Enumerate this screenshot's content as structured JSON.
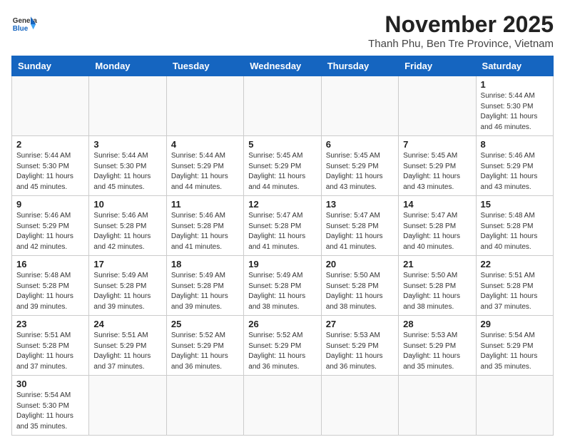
{
  "header": {
    "logo_general": "General",
    "logo_blue": "Blue",
    "month_title": "November 2025",
    "location": "Thanh Phu, Ben Tre Province, Vietnam"
  },
  "days_of_week": [
    "Sunday",
    "Monday",
    "Tuesday",
    "Wednesday",
    "Thursday",
    "Friday",
    "Saturday"
  ],
  "weeks": [
    [
      {
        "day": "",
        "info": ""
      },
      {
        "day": "",
        "info": ""
      },
      {
        "day": "",
        "info": ""
      },
      {
        "day": "",
        "info": ""
      },
      {
        "day": "",
        "info": ""
      },
      {
        "day": "",
        "info": ""
      },
      {
        "day": "1",
        "info": "Sunrise: 5:44 AM\nSunset: 5:30 PM\nDaylight: 11 hours\nand 46 minutes."
      }
    ],
    [
      {
        "day": "2",
        "info": "Sunrise: 5:44 AM\nSunset: 5:30 PM\nDaylight: 11 hours\nand 45 minutes."
      },
      {
        "day": "3",
        "info": "Sunrise: 5:44 AM\nSunset: 5:30 PM\nDaylight: 11 hours\nand 45 minutes."
      },
      {
        "day": "4",
        "info": "Sunrise: 5:44 AM\nSunset: 5:29 PM\nDaylight: 11 hours\nand 44 minutes."
      },
      {
        "day": "5",
        "info": "Sunrise: 5:45 AM\nSunset: 5:29 PM\nDaylight: 11 hours\nand 44 minutes."
      },
      {
        "day": "6",
        "info": "Sunrise: 5:45 AM\nSunset: 5:29 PM\nDaylight: 11 hours\nand 43 minutes."
      },
      {
        "day": "7",
        "info": "Sunrise: 5:45 AM\nSunset: 5:29 PM\nDaylight: 11 hours\nand 43 minutes."
      },
      {
        "day": "8",
        "info": "Sunrise: 5:46 AM\nSunset: 5:29 PM\nDaylight: 11 hours\nand 43 minutes."
      }
    ],
    [
      {
        "day": "9",
        "info": "Sunrise: 5:46 AM\nSunset: 5:29 PM\nDaylight: 11 hours\nand 42 minutes."
      },
      {
        "day": "10",
        "info": "Sunrise: 5:46 AM\nSunset: 5:28 PM\nDaylight: 11 hours\nand 42 minutes."
      },
      {
        "day": "11",
        "info": "Sunrise: 5:46 AM\nSunset: 5:28 PM\nDaylight: 11 hours\nand 41 minutes."
      },
      {
        "day": "12",
        "info": "Sunrise: 5:47 AM\nSunset: 5:28 PM\nDaylight: 11 hours\nand 41 minutes."
      },
      {
        "day": "13",
        "info": "Sunrise: 5:47 AM\nSunset: 5:28 PM\nDaylight: 11 hours\nand 41 minutes."
      },
      {
        "day": "14",
        "info": "Sunrise: 5:47 AM\nSunset: 5:28 PM\nDaylight: 11 hours\nand 40 minutes."
      },
      {
        "day": "15",
        "info": "Sunrise: 5:48 AM\nSunset: 5:28 PM\nDaylight: 11 hours\nand 40 minutes."
      }
    ],
    [
      {
        "day": "16",
        "info": "Sunrise: 5:48 AM\nSunset: 5:28 PM\nDaylight: 11 hours\nand 39 minutes."
      },
      {
        "day": "17",
        "info": "Sunrise: 5:49 AM\nSunset: 5:28 PM\nDaylight: 11 hours\nand 39 minutes."
      },
      {
        "day": "18",
        "info": "Sunrise: 5:49 AM\nSunset: 5:28 PM\nDaylight: 11 hours\nand 39 minutes."
      },
      {
        "day": "19",
        "info": "Sunrise: 5:49 AM\nSunset: 5:28 PM\nDaylight: 11 hours\nand 38 minutes."
      },
      {
        "day": "20",
        "info": "Sunrise: 5:50 AM\nSunset: 5:28 PM\nDaylight: 11 hours\nand 38 minutes."
      },
      {
        "day": "21",
        "info": "Sunrise: 5:50 AM\nSunset: 5:28 PM\nDaylight: 11 hours\nand 38 minutes."
      },
      {
        "day": "22",
        "info": "Sunrise: 5:51 AM\nSunset: 5:28 PM\nDaylight: 11 hours\nand 37 minutes."
      }
    ],
    [
      {
        "day": "23",
        "info": "Sunrise: 5:51 AM\nSunset: 5:28 PM\nDaylight: 11 hours\nand 37 minutes."
      },
      {
        "day": "24",
        "info": "Sunrise: 5:51 AM\nSunset: 5:29 PM\nDaylight: 11 hours\nand 37 minutes."
      },
      {
        "day": "25",
        "info": "Sunrise: 5:52 AM\nSunset: 5:29 PM\nDaylight: 11 hours\nand 36 minutes."
      },
      {
        "day": "26",
        "info": "Sunrise: 5:52 AM\nSunset: 5:29 PM\nDaylight: 11 hours\nand 36 minutes."
      },
      {
        "day": "27",
        "info": "Sunrise: 5:53 AM\nSunset: 5:29 PM\nDaylight: 11 hours\nand 36 minutes."
      },
      {
        "day": "28",
        "info": "Sunrise: 5:53 AM\nSunset: 5:29 PM\nDaylight: 11 hours\nand 35 minutes."
      },
      {
        "day": "29",
        "info": "Sunrise: 5:54 AM\nSunset: 5:29 PM\nDaylight: 11 hours\nand 35 minutes."
      }
    ],
    [
      {
        "day": "30",
        "info": "Sunrise: 5:54 AM\nSunset: 5:30 PM\nDaylight: 11 hours\nand 35 minutes."
      },
      {
        "day": "",
        "info": ""
      },
      {
        "day": "",
        "info": ""
      },
      {
        "day": "",
        "info": ""
      },
      {
        "day": "",
        "info": ""
      },
      {
        "day": "",
        "info": ""
      },
      {
        "day": "",
        "info": ""
      }
    ]
  ]
}
